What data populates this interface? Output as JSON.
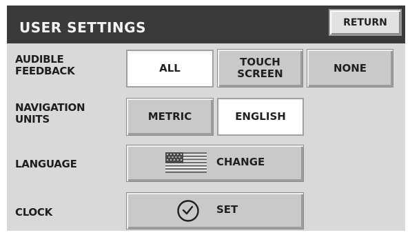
{
  "header": {
    "title": "USER SETTINGS",
    "return_label": "RETURN"
  },
  "rows": {
    "audible_feedback": {
      "label": "AUDIBLE FEEDBACK",
      "options": [
        "ALL",
        "TOUCH SCREEN",
        "NONE"
      ],
      "selected": "ALL"
    },
    "navigation_units": {
      "label": "NAVIGATION UNITS",
      "options": [
        "METRIC",
        "ENGLISH"
      ],
      "selected": "ENGLISH"
    },
    "language": {
      "label": "LANGUAGE",
      "button_label": "CHANGE",
      "icon": "us-flag-icon"
    },
    "clock": {
      "label": "CLOCK",
      "button_label": "SET",
      "icon": "clock-icon"
    }
  },
  "colors": {
    "header_bg": "#3a3a3a",
    "panel_bg": "#d9d9d9",
    "button_bg": "#c9c9c9",
    "selected_bg": "#ffffff"
  }
}
